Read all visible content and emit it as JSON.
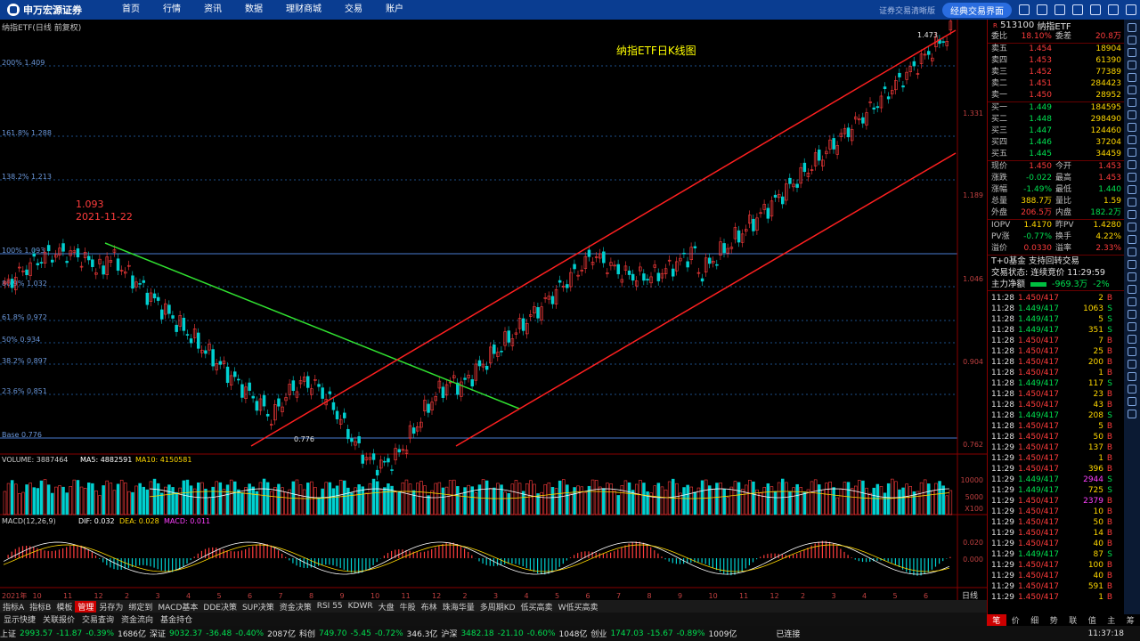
{
  "app": {
    "logo": "申万宏源证券",
    "menu": [
      "首页",
      "行情",
      "资讯",
      "数据",
      "理财商城",
      "交易",
      "账户"
    ],
    "classic": "经典交易界面",
    "hint": "证券交易清晰版"
  },
  "chart": {
    "title": "纳指ETF(日线 前复权)",
    "main_title": "纳指ETF日K线图",
    "hi_label": "1.093",
    "hi_date": "2021-11-22",
    "lo_label": "0.776",
    "top_label": "1.473",
    "fibo": [
      "200% 1.409",
      "161.8% 1.288",
      "138.2% 1.213",
      "100% 1.093",
      "80.9% 1.032",
      "61.8% 0.972",
      "50% 0.934",
      "38.2% 0.897",
      "23.6% 0.851",
      "Base 0.776"
    ],
    "yaxis": [
      "1.331",
      "1.189",
      "1.046",
      "0.904",
      "0.762"
    ],
    "vol_line": {
      "pre": "VOLUME: 3887464",
      "ma5": "MA5: 4882591",
      "ma10": "MA10: 4150581"
    },
    "vol_axis": [
      "10000",
      "5000",
      "X100"
    ],
    "macd_line": {
      "pre": "MACD(12,26,9)",
      "dif": "DIF: 0.032",
      "dea": "DEA: 0.028",
      "macd": "MACD: 0.011"
    },
    "macd_axis": [
      "0.020",
      "0.000"
    ],
    "xaxis": [
      "2021年",
      "10",
      "11",
      "12",
      "2",
      "3",
      "4",
      "5",
      "6",
      "7",
      "8",
      "9",
      "10",
      "11",
      "12",
      "2",
      "3",
      "4",
      "5",
      "6",
      "7",
      "8",
      "9",
      "10",
      "11",
      "12",
      "2",
      "3",
      "4",
      "5",
      "6"
    ],
    "period": "日线"
  },
  "panel": {
    "code": "513100",
    "name": "纳指ETF",
    "weibi": {
      "l": "委比",
      "v": "18.10%",
      "l2": "委差",
      "v2": "20.8万"
    },
    "sell": [
      {
        "l": "卖五",
        "p": "1.454",
        "v": "18904"
      },
      {
        "l": "卖四",
        "p": "1.453",
        "v": "61390"
      },
      {
        "l": "卖三",
        "p": "1.452",
        "v": "77389"
      },
      {
        "l": "卖二",
        "p": "1.451",
        "v": "284423"
      },
      {
        "l": "卖一",
        "p": "1.450",
        "v": "28952"
      }
    ],
    "buy": [
      {
        "l": "买一",
        "p": "1.449",
        "v": "184595"
      },
      {
        "l": "买二",
        "p": "1.448",
        "v": "298490"
      },
      {
        "l": "买三",
        "p": "1.447",
        "v": "124460"
      },
      {
        "l": "买四",
        "p": "1.446",
        "v": "37204"
      },
      {
        "l": "买五",
        "p": "1.445",
        "v": "34459"
      }
    ],
    "quote": [
      [
        "现价",
        "1.450",
        "今开",
        "1.453"
      ],
      [
        "涨跌",
        "-0.022",
        "最高",
        "1.453"
      ],
      [
        "涨幅",
        "-1.49%",
        "最低",
        "1.440"
      ],
      [
        "总量",
        "388.7万",
        "量比",
        "1.59"
      ],
      [
        "外盘",
        "206.5万",
        "内盘",
        "182.2万"
      ]
    ],
    "iopv": [
      [
        "IOPV",
        "1.4170",
        "昨PV",
        "1.4280"
      ],
      [
        "PV涨",
        "-0.77%",
        "换手",
        "4.22%"
      ],
      [
        "溢价",
        "0.0330",
        "溢率",
        "2.33%"
      ]
    ],
    "t0": "T+0基金 支持回转交易",
    "state": "交易状态: 连续竞价 11:29:59",
    "flow": {
      "l": "主力净额",
      "v": "-969.3万",
      "p": "-2%"
    },
    "ticks": [
      [
        "11:28",
        "1.450/417",
        "2",
        "B"
      ],
      [
        "11:28",
        "1.449/417",
        "1063",
        "S"
      ],
      [
        "11:28",
        "1.449/417",
        "5",
        "S"
      ],
      [
        "11:28",
        "1.449/417",
        "351",
        "S"
      ],
      [
        "11:28",
        "1.450/417",
        "7",
        "B"
      ],
      [
        "11:28",
        "1.450/417",
        "25",
        "B"
      ],
      [
        "11:28",
        "1.450/417",
        "200",
        "B"
      ],
      [
        "11:28",
        "1.450/417",
        "1",
        "B"
      ],
      [
        "11:28",
        "1.449/417",
        "117",
        "S"
      ],
      [
        "11:28",
        "1.450/417",
        "23",
        "B"
      ],
      [
        "11:28",
        "1.450/417",
        "43",
        "B"
      ],
      [
        "11:28",
        "1.449/417",
        "208",
        "S"
      ],
      [
        "11:28",
        "1.450/417",
        "5",
        "B"
      ],
      [
        "11:28",
        "1.450/417",
        "50",
        "B"
      ],
      [
        "11:29",
        "1.450/417",
        "137",
        "B"
      ],
      [
        "11:29",
        "1.450/417",
        "1",
        "B"
      ],
      [
        "11:29",
        "1.450/417",
        "396",
        "B"
      ],
      [
        "11:29",
        "1.449/417",
        "2944",
        "S"
      ],
      [
        "11:29",
        "1.449/417",
        "725",
        "S"
      ],
      [
        "11:29",
        "1.450/417",
        "2379",
        "B"
      ],
      [
        "11:29",
        "1.450/417",
        "10",
        "B"
      ],
      [
        "11:29",
        "1.450/417",
        "50",
        "B"
      ],
      [
        "11:29",
        "1.450/417",
        "14",
        "B"
      ],
      [
        "11:29",
        "1.450/417",
        "40",
        "B"
      ],
      [
        "11:29",
        "1.449/417",
        "87",
        "S"
      ],
      [
        "11:29",
        "1.450/417",
        "100",
        "B"
      ],
      [
        "11:29",
        "1.450/417",
        "40",
        "B"
      ],
      [
        "11:29",
        "1.450/417",
        "591",
        "B"
      ],
      [
        "11:29",
        "1.450/417",
        "1",
        "B"
      ]
    ],
    "tabs": [
      "笔",
      "价",
      "细",
      "势",
      "联",
      "值",
      "主",
      "筹"
    ]
  },
  "bottom": {
    "tabs": [
      "指标A",
      "指标B",
      "模板",
      "管理",
      "另存为",
      "绑定到",
      "MACD基本",
      "DDE决策",
      "SUP决策",
      "资金决策",
      "RSI 55",
      "KDWR",
      "大盘",
      "牛股",
      "布林",
      "珠海华量",
      "多周期KD",
      "低买高卖",
      "W低买高卖"
    ],
    "tabs2": [
      "显示快捷",
      "关联报价",
      "交易查询",
      "资金流向",
      "基金持仓"
    ]
  },
  "status": {
    "items": [
      [
        "上证",
        "2993.57",
        "-11.87",
        "-0.39%",
        "1686亿"
      ],
      [
        "深证",
        "9032.37",
        "-36.48",
        "-0.40%",
        "2087亿"
      ],
      [
        "科创",
        "749.70",
        "-5.45",
        "-0.72%",
        "346.3亿"
      ],
      [
        "沪深",
        "3482.18",
        "-21.10",
        "-0.60%",
        "1048亿"
      ],
      [
        "创业",
        "1747.03",
        "-15.67",
        "-0.89%",
        "1009亿"
      ]
    ],
    "conn": "已连接",
    "time": "11:37:18"
  },
  "colors": {
    "up": "#ff3c3c",
    "down": "#00e0e0",
    "bg": "#000000",
    "brand": "#0a3d91"
  }
}
